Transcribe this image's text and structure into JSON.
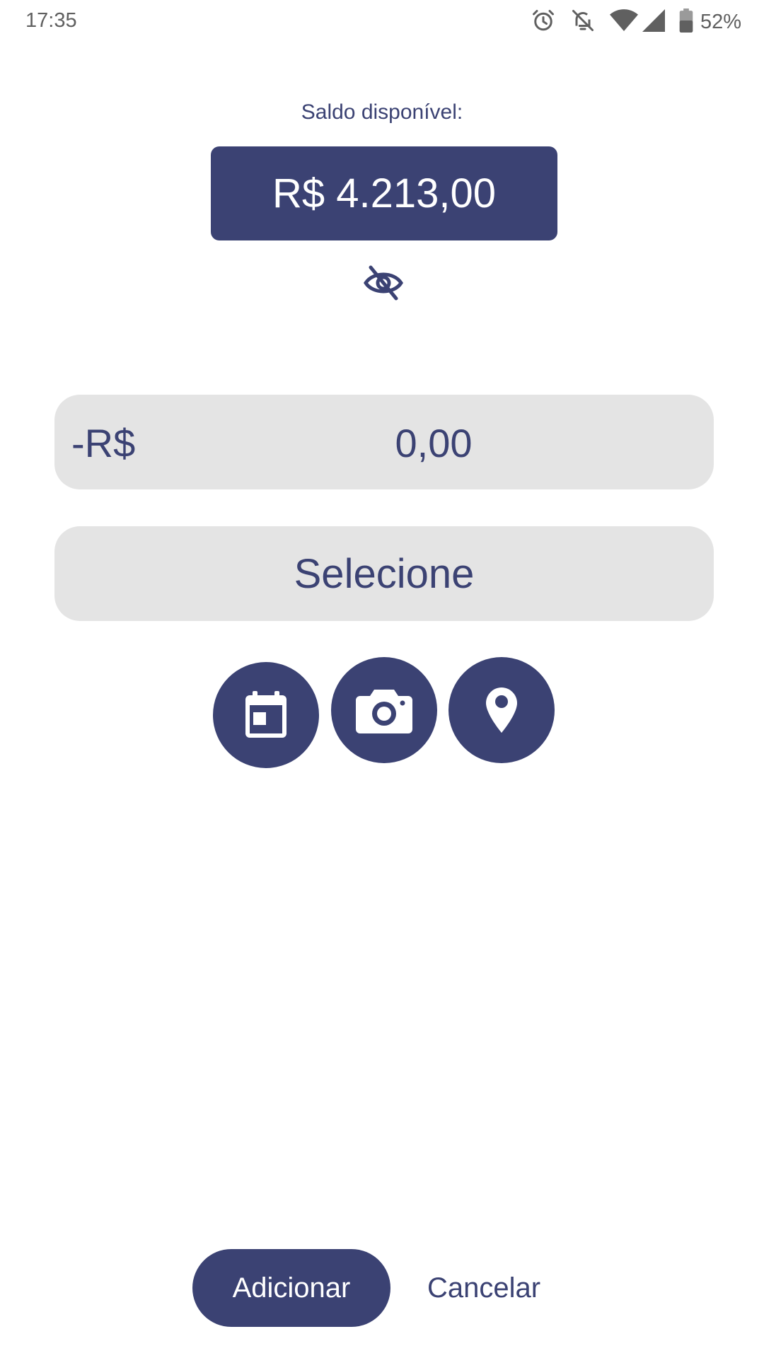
{
  "status_bar": {
    "time": "17:35",
    "battery": "52%",
    "icons": [
      "alarm-icon",
      "notifications-off-icon",
      "wifi-icon",
      "signal-icon",
      "battery-icon"
    ]
  },
  "balance": {
    "label": "Saldo disponível:",
    "value": "R$ 4.213,00",
    "visibility_icon": "eye-off-icon"
  },
  "amount_field": {
    "prefix": "-R$",
    "value": "0,00"
  },
  "category_select": {
    "value": "Selecione"
  },
  "actions": {
    "icons": [
      "calendar-icon",
      "camera-icon",
      "location-pin-icon"
    ]
  },
  "footer": {
    "add_label": "Adicionar",
    "cancel_label": "Cancelar"
  },
  "colors": {
    "primary": "#3b4273",
    "field_bg": "#e4e4e4",
    "status_text": "#606060"
  }
}
